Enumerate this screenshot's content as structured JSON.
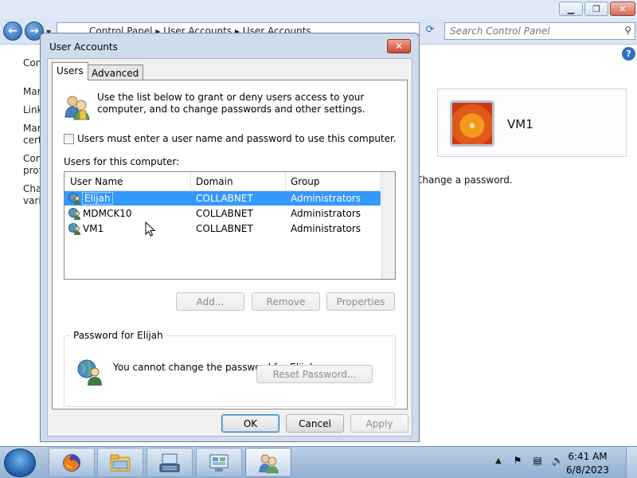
{
  "background_window": {
    "address_parts": [
      "Control Panel",
      "User Accounts",
      "User Accounts"
    ],
    "search_placeholder": "Search Control Panel",
    "left_links": [
      "Con",
      "Mar",
      "Link",
      "Mar",
      "certi",
      "Con",
      "prof",
      "Cha",
      "varia"
    ],
    "user_card_name": "VM1",
    "change_password_text": "Change a password."
  },
  "dialog": {
    "title": "User Accounts",
    "tabs": [
      "Users",
      "Advanced"
    ],
    "intro_text": "Use the list below to grant or deny users access to your computer, and to change passwords and other settings.",
    "require_login_label": "Users must enter a user name and password to use this computer.",
    "users_caption": "Users for this computer:",
    "columns": [
      "User Name",
      "Domain",
      "Group"
    ],
    "users": [
      {
        "name": "Elijah",
        "domain": "COLLABNET",
        "group": "Administrators",
        "selected": true
      },
      {
        "name": "MDMCK10",
        "domain": "COLLABNET",
        "group": "Administrators",
        "selected": false
      },
      {
        "name": "VM1",
        "domain": "COLLABNET",
        "group": "Administrators",
        "selected": false
      }
    ],
    "buttons": {
      "add": "Add...",
      "remove": "Remove",
      "properties": "Properties",
      "reset_password": "Reset Password...",
      "ok": "OK",
      "cancel": "Cancel",
      "apply": "Apply"
    },
    "password_group_title": "Password for Elijah",
    "password_message": "You cannot change the password for Elijah."
  },
  "taskbar": {
    "time": "6:41 AM",
    "date": "6/8/2023",
    "pinned_icons": [
      "firefox-icon",
      "file-explorer-icon",
      "keyboard-icon",
      "control-panel-icon",
      "user-accounts-icon"
    ]
  },
  "colors": {
    "selection": "#3399ff",
    "dialog_frame": "#cfdceb",
    "taskbar": "#bcd0e6"
  }
}
